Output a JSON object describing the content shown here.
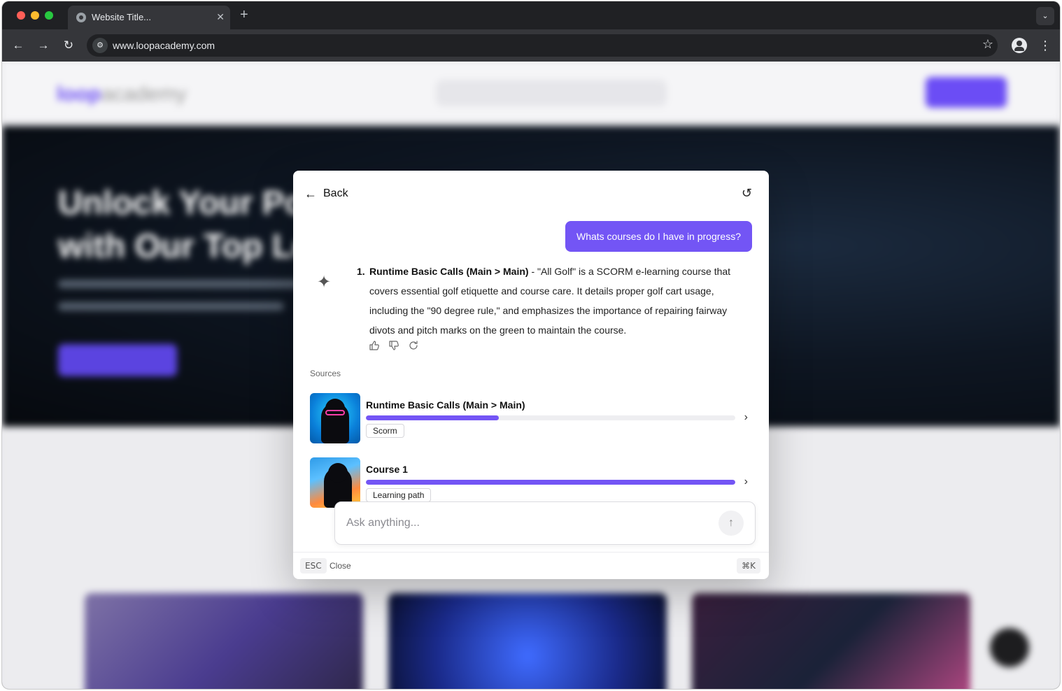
{
  "browser": {
    "tab_title": "Website Title...",
    "tab_close": "✕",
    "new_tab": "+",
    "tab_menu": "⌄",
    "url": "www.loopacademy.com",
    "back": "←",
    "forward": "→",
    "reload": "↻",
    "star": "☆",
    "menu": "⋮",
    "site_info_icon": "⚙"
  },
  "background_page": {
    "logo_primary": "loop",
    "logo_secondary": "academy",
    "hero_title_line1": "Unlock Your Pot",
    "hero_title_line2": "with Our Top Le"
  },
  "chat": {
    "back_label": "Back",
    "back_icon": "←",
    "reset_icon": "↺",
    "user_message": "Whats courses do I have in progress?",
    "ai_icon": "✦",
    "answer": {
      "number": "1.",
      "title": "Runtime Basic Calls (Main > Main)",
      "text": " - \"All Golf\" is a SCORM e-learning course that covers essential golf etiquette and course care. It details proper golf cart usage, including the \"90 degree rule,\" and emphasizes the importance of repairing fairway divots and pitch marks on the green to maintain the course."
    },
    "feedback_icons": [
      "thumbs-up-icon",
      "thumbs-down-icon",
      "regenerate-icon"
    ],
    "sources_label": "Sources",
    "sources": [
      {
        "title": "Runtime Basic Calls (Main > Main)",
        "progress": 0.36,
        "tag": "Scorm"
      },
      {
        "title": "Course 1",
        "progress": 1.0,
        "tag": "Learning path"
      }
    ],
    "input_placeholder": "Ask anything...",
    "send_icon": "↑",
    "footer": {
      "esc_key": "ESC",
      "close_label": "Close",
      "shortcut": "⌘K"
    }
  },
  "colors": {
    "accent": "#7355f5",
    "browser_chrome": "#202124"
  }
}
